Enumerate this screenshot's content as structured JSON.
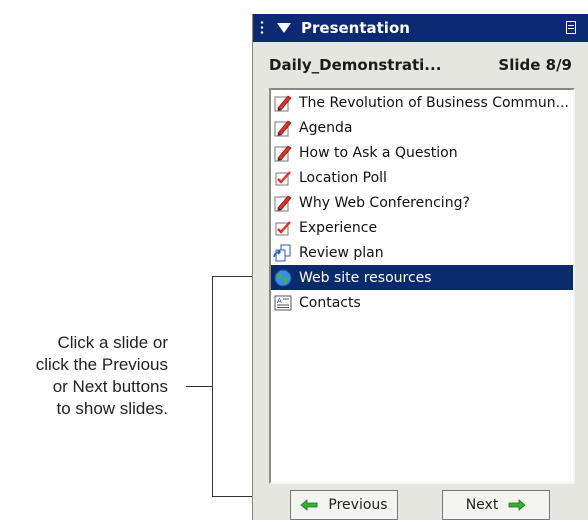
{
  "callout": {
    "lines": [
      "Click a slide or",
      "click the Previous",
      "or Next buttons",
      "to show slides."
    ]
  },
  "panel": {
    "title": "Presentation",
    "file_name": "Daily_Demonstrati...",
    "slide_indicator": "Slide 8/9",
    "items": [
      {
        "label": "The Revolution of Business Commun...",
        "icon": "slide-edit-icon"
      },
      {
        "label": "Agenda",
        "icon": "slide-edit-icon"
      },
      {
        "label": "How to Ask a Question",
        "icon": "slide-edit-icon"
      },
      {
        "label": "Location Poll",
        "icon": "poll-check-icon"
      },
      {
        "label": "Why Web Conferencing?",
        "icon": "slide-edit-icon"
      },
      {
        "label": "Experience",
        "icon": "poll-check-icon"
      },
      {
        "label": "Review plan",
        "icon": "sync-pages-icon"
      },
      {
        "label": "Web site resources",
        "icon": "globe-icon",
        "selected": true
      },
      {
        "label": "Contacts",
        "icon": "contact-card-icon"
      }
    ],
    "buttons": {
      "previous": "Previous",
      "next": "Next"
    },
    "colors": {
      "title_bar": "#0c2a74",
      "selection": "#0a2a6e",
      "arrow": "#2fb52f"
    }
  }
}
